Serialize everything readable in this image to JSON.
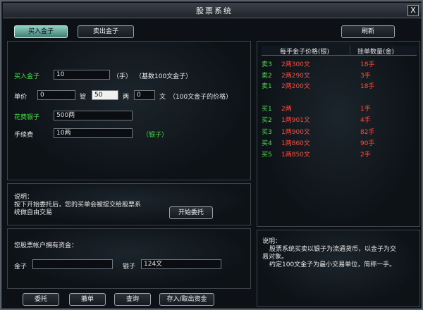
{
  "window": {
    "title": "股票系统",
    "close_label": "X"
  },
  "top_buttons": {
    "buy": "买入金子",
    "sell": "卖出金子",
    "refresh": "刷新"
  },
  "buy_form": {
    "gold_label": "买入金子",
    "gold_value": "10",
    "gold_unit": "（手）",
    "gold_note": "（基数100文金子）",
    "price_label": "单价",
    "price_ding_value": "0",
    "ding_unit": "锭",
    "price_liang_value": "50",
    "liang_unit": "两",
    "price_wen_value": "0",
    "wen_unit": "文",
    "price_note": "（100文金子的价格）",
    "cost_label": "花费银子",
    "cost_value": "500两",
    "fee_label": "手续费",
    "fee_value": "10两",
    "fee_unit": "（银子）"
  },
  "instructions": {
    "title": "说明：",
    "line1": "按下开始委托后，您的买单会被提交给股票系",
    "line2": "统做自由交易",
    "start_button": "开始委托"
  },
  "account": {
    "title": "您股票帐户拥有资金：",
    "gold_label": "金子",
    "gold_value": "",
    "silver_label": "银子",
    "silver_value": "124文"
  },
  "bottom_buttons": {
    "orders": "委托",
    "cancel": "撤单",
    "query": "查询",
    "deposit": "存入/取出资金"
  },
  "order_book": {
    "price_header": "每手金子价格(银)",
    "qty_header": "挂单数量(金)",
    "sells": [
      {
        "label": "卖3",
        "price": "2两300文",
        "qty": "18手"
      },
      {
        "label": "卖2",
        "price": "2两290文",
        "qty": "3手"
      },
      {
        "label": "卖1",
        "price": "2两200文",
        "qty": "18手"
      }
    ],
    "buys": [
      {
        "label": "买1",
        "price": "2两",
        "qty": "1手"
      },
      {
        "label": "买2",
        "price": "1两901文",
        "qty": "4手"
      },
      {
        "label": "买3",
        "price": "1两900文",
        "qty": "82手"
      },
      {
        "label": "买4",
        "price": "1两860文",
        "qty": "90手"
      },
      {
        "label": "买5",
        "price": "1两850文",
        "qty": "2手"
      }
    ]
  },
  "help": {
    "title": "说明：",
    "line1": "股票系统买卖以银子为流通货币，以金子为交",
    "line2": "易对象。",
    "line3": "约定100文金子为最小交易单位，简称一手。"
  },
  "colors": {
    "sell": "#ff4a3a",
    "buy_label": "#45e04a",
    "accent": "#8fd1c0"
  }
}
